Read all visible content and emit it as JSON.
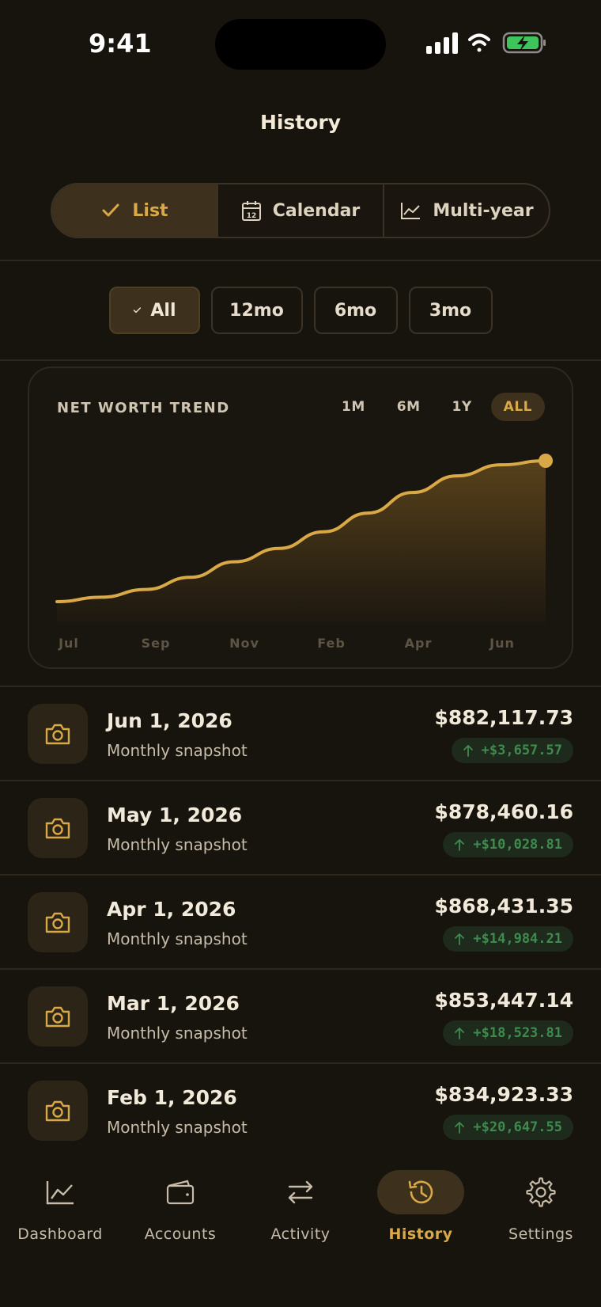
{
  "status_bar": {
    "time": "9:41"
  },
  "header": {
    "title": "History"
  },
  "view_switcher": {
    "items": [
      {
        "label": "List",
        "icon": "check-icon",
        "active": true
      },
      {
        "label": "Calendar",
        "icon": "calendar-icon",
        "active": false
      },
      {
        "label": "Multi-year",
        "icon": "line-chart-icon",
        "active": false
      }
    ]
  },
  "period_filter": {
    "items": [
      {
        "label": "All",
        "active": true
      },
      {
        "label": "12mo",
        "active": false
      },
      {
        "label": "6mo",
        "active": false
      },
      {
        "label": "3mo",
        "active": false
      }
    ]
  },
  "trend_card": {
    "title": "NET WORTH TREND",
    "ranges": [
      {
        "label": "1M",
        "active": false
      },
      {
        "label": "6M",
        "active": false
      },
      {
        "label": "1Y",
        "active": false
      },
      {
        "label": "ALL",
        "active": true
      }
    ],
    "x_labels": [
      "Jul",
      "Sep",
      "Nov",
      "Feb",
      "Apr",
      "Jun"
    ]
  },
  "chart_data": {
    "type": "area",
    "title": "NET WORTH TREND",
    "xlabel": "",
    "ylabel": "",
    "x_tick_labels": [
      "Jul",
      "Sep",
      "Nov",
      "Feb",
      "Apr",
      "Jun"
    ],
    "x": [
      "Jul",
      "Aug",
      "Sep",
      "Oct",
      "Nov",
      "Dec",
      "Jan",
      "Feb",
      "Mar",
      "Apr",
      "May",
      "Jun"
    ],
    "series": [
      {
        "values": [
          755000,
          759000,
          766000,
          777000,
          791000,
          803000,
          818000,
          834923.33,
          853447.14,
          868431.35,
          878460.16,
          882117.73
        ]
      }
    ],
    "grid": false,
    "legend": "none"
  },
  "snapshots": [
    {
      "date": "Jun 1, 2026",
      "subtitle": "Monthly snapshot",
      "amount": "$882,117.73",
      "delta": "+$3,657.57"
    },
    {
      "date": "May 1, 2026",
      "subtitle": "Monthly snapshot",
      "amount": "$878,460.16",
      "delta": "+$10,028.81"
    },
    {
      "date": "Apr 1, 2026",
      "subtitle": "Monthly snapshot",
      "amount": "$868,431.35",
      "delta": "+$14,984.21"
    },
    {
      "date": "Mar 1, 2026",
      "subtitle": "Monthly snapshot",
      "amount": "$853,447.14",
      "delta": "+$18,523.81"
    },
    {
      "date": "Feb 1, 2026",
      "subtitle": "Monthly snapshot",
      "amount": "$834,923.33",
      "delta": "+$20,647.55"
    }
  ],
  "tab_bar": {
    "items": [
      {
        "label": "Dashboard",
        "icon": "line-chart-icon",
        "active": false
      },
      {
        "label": "Accounts",
        "icon": "wallet-icon",
        "active": false
      },
      {
        "label": "Activity",
        "icon": "transfer-arrows-icon",
        "active": false
      },
      {
        "label": "History",
        "icon": "history-clock-icon",
        "active": true
      },
      {
        "label": "Settings",
        "icon": "gear-icon",
        "active": false
      }
    ]
  },
  "colors": {
    "accent": "#d9a948",
    "positive": "#3f8a4e",
    "background": "#17130d"
  }
}
